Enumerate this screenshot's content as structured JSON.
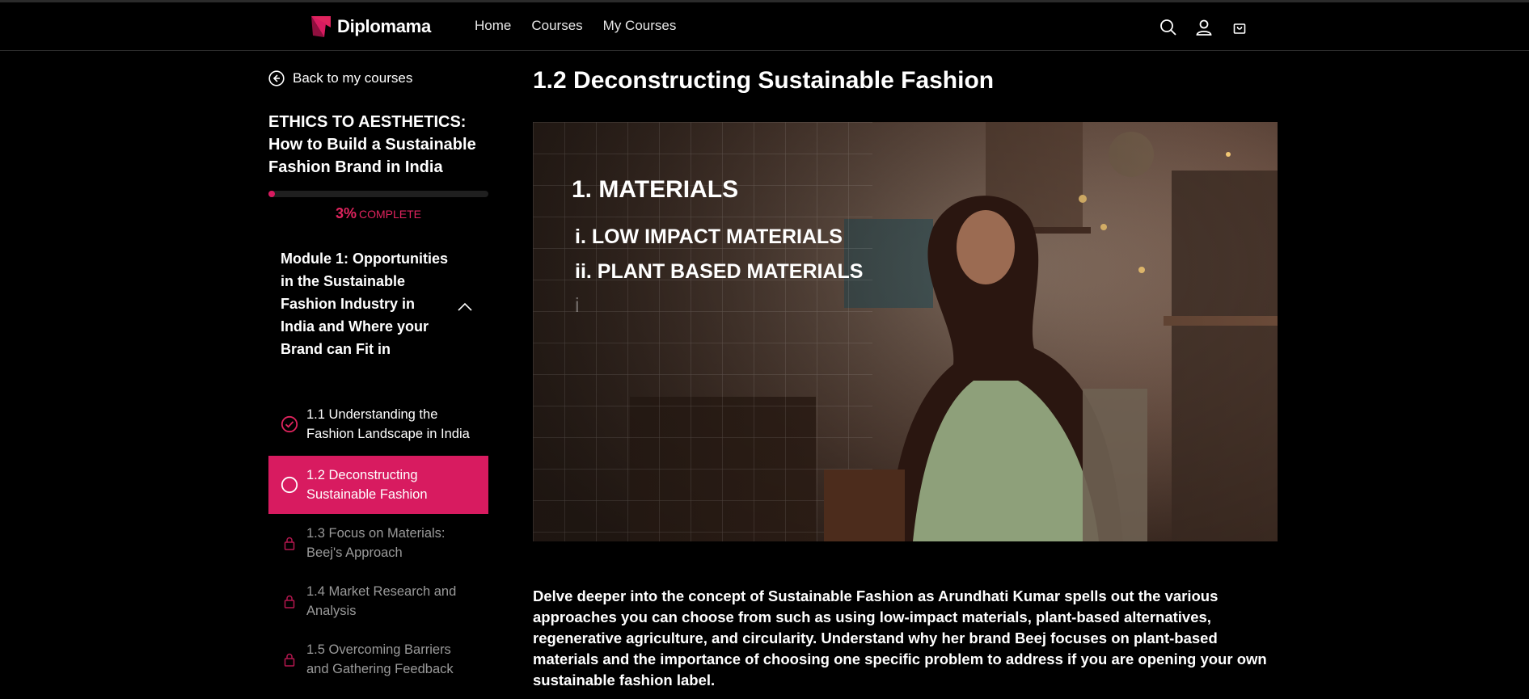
{
  "header": {
    "logo_text": "Diplomama",
    "brand_color": "#d81b60",
    "nav": [
      {
        "label": "Home"
      },
      {
        "label": "Courses"
      },
      {
        "label": "My Courses"
      }
    ],
    "icons": [
      "search-icon",
      "account-icon",
      "cart-icon"
    ]
  },
  "sidebar": {
    "back_label": "Back to my courses",
    "course_title": "ETHICS TO AESTHETICS: How to Build a Sustainable Fashion Brand in India",
    "progress": {
      "percent": 3,
      "percent_text": "3%",
      "label": "COMPLETE"
    },
    "module_title": "Module 1: Opportunities in the Sustainable Fashion Industry in India and Where your Brand can Fit in",
    "lessons": [
      {
        "label": "1.1 Understanding the Fashion Landscape in India",
        "state": "completed"
      },
      {
        "label": "1.2 Deconstructing Sustainable Fashion",
        "state": "active"
      },
      {
        "label": "1.3 Focus on Materials: Beej's Approach",
        "state": "locked"
      },
      {
        "label": "1.4 Market Research and Analysis",
        "state": "locked"
      },
      {
        "label": "1.5 Overcoming Barriers and Gathering Feedback",
        "state": "locked"
      }
    ]
  },
  "main": {
    "title": "1.2 Deconstructing Sustainable Fashion",
    "video": {
      "heading": "1. MATERIALS",
      "item1": "i. LOW IMPACT MATERIALS",
      "item2": "ii. PLANT BASED MATERIALS",
      "item3": "i"
    },
    "description": "Delve deeper into the concept of Sustainable Fashion as Arundhati Kumar spells out the various approaches you can choose from such as using low-impact materials, plant-based alternatives, regenerative agriculture, and circularity. Understand why her brand Beej focuses on plant-based materials and the importance of choosing one specific problem to address if you are opening your own sustainable fashion label."
  }
}
